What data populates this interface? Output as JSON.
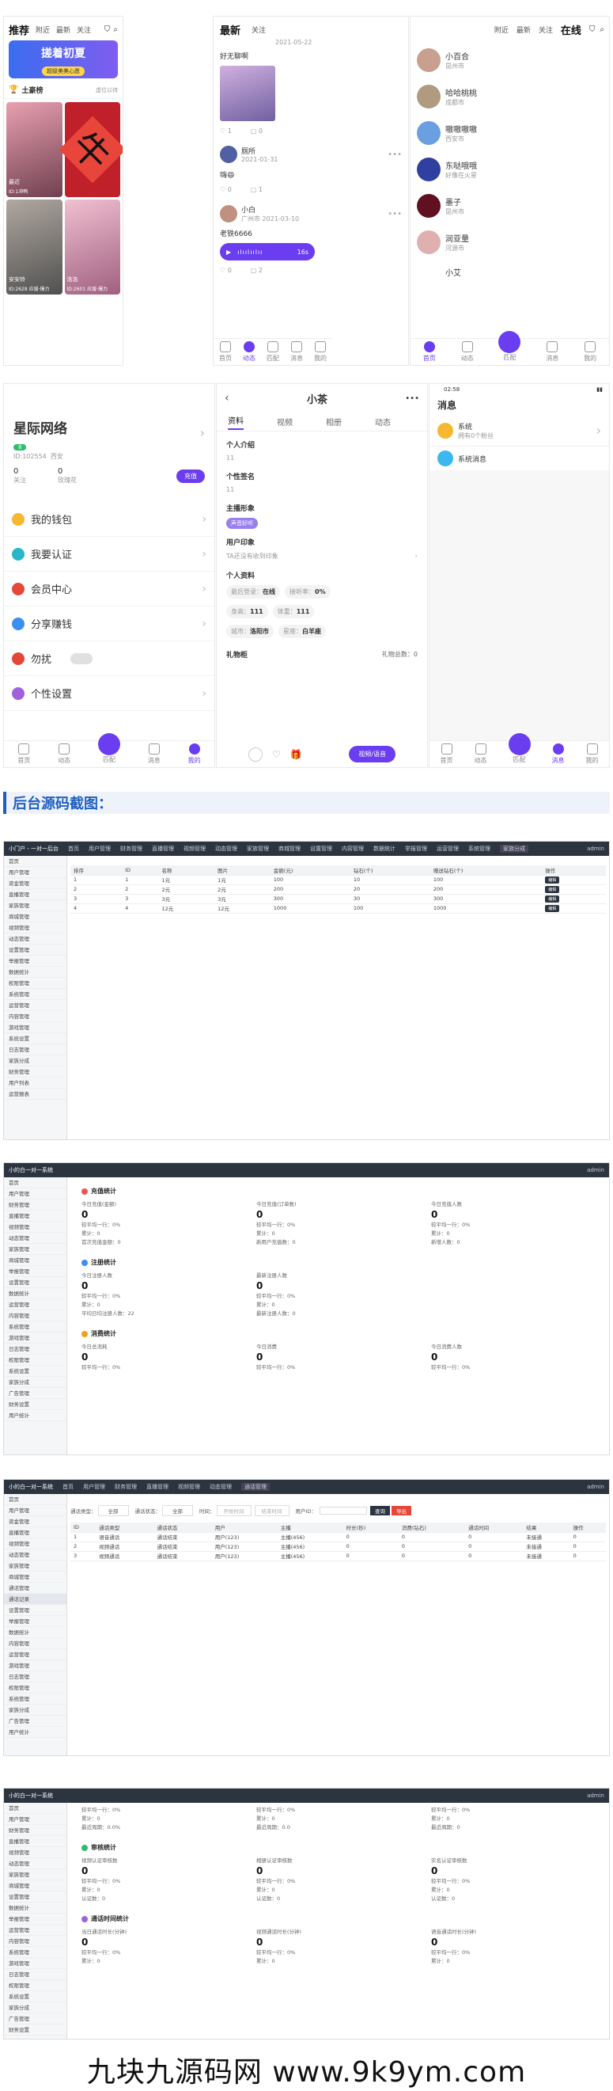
{
  "screen1": {
    "tabs": [
      "推荐",
      "附近",
      "最新",
      "关注"
    ],
    "banner_title": "搓着初夏",
    "banner_sub": "超级美美心愿",
    "rank_title": "土豪榜",
    "rank_more": "虚位以待",
    "card1_name": "安安铃",
    "card1_sub": "ID:2628 应援·爆力",
    "card2_name": "洛洛",
    "card2_sub": "ID:2601 应援·爆力",
    "card3_name": "最近",
    "card3_sub": "ID:1冲鸭",
    "fu_char": "牛"
  },
  "screen2": {
    "tabs": [
      "最新",
      "关注"
    ],
    "post1_text": "好无聊啊",
    "post1_date": "2021-05-22",
    "post2_name": "厕所",
    "post2_date": "2021-01-31",
    "post2_text": "嗨😄",
    "post3_name": "小白",
    "post3_loc": "广州市",
    "post3_date": "2021-03-10",
    "post3_text": "老铁6666",
    "voice_len": "16s",
    "likes": [
      "1",
      "0",
      "0",
      "1",
      "0",
      "2"
    ]
  },
  "screen3": {
    "tabs": [
      "附近",
      "最新",
      "关注",
      "在线"
    ],
    "users": [
      {
        "name": "小百合",
        "sub": "昆州市"
      },
      {
        "name": "哈哈桃桃",
        "sub": "成都市"
      },
      {
        "name": "嗷嗷嗷嗷",
        "sub": "西安市"
      },
      {
        "name": "东哒哦哦",
        "sub": "好像在火星"
      },
      {
        "name": "墨子",
        "sub": "昆州市"
      },
      {
        "name": "润亚量",
        "sub": "河源市"
      },
      {
        "name": "小艾",
        "sub": ""
      }
    ]
  },
  "tabbar_labels": [
    "首页",
    "动态",
    "匹配",
    "消息",
    "我的"
  ],
  "screen4": {
    "name": "星际网络",
    "badge": "8",
    "id": "ID:102554",
    "city": "西安",
    "follow_num": "0",
    "follow_label": "关注",
    "fans_num": "0",
    "fans_label": "玫瑰花",
    "recharge": "充值",
    "menu": [
      "我的钱包",
      "我要认证",
      "会员中心",
      "分享赚钱",
      "勿扰",
      "个性设置"
    ]
  },
  "screen5": {
    "title": "小茶",
    "tabs": [
      "资料",
      "视频",
      "相册",
      "动态"
    ],
    "intro_h": "个人介绍",
    "intro_v": "11",
    "sign_h": "个性签名",
    "sign_v": "11",
    "image_h": "主播形象",
    "image_tag": "声音好听",
    "impress_h": "用户印象",
    "impress_v": "TA还没有收到印象",
    "profile_h": "个人资料",
    "last_login": "最后登录：",
    "last_login_v": "在线",
    "rate": "接听率：",
    "rate_v": "0%",
    "height_l": "身高：",
    "height_v": "111",
    "weight_l": "体重：",
    "weight_v": "111",
    "city_l": "城市：",
    "city_v": "洛阳市",
    "sign2_l": "星座：",
    "sign2_v": "白羊座",
    "gift_h": "礼物柜",
    "gift_total": "礼物总数：0",
    "call_btn": "视频/语音"
  },
  "screen6": {
    "time": "02:58",
    "title": "消息",
    "items": [
      {
        "name": "系统",
        "sub": "拥有0个粉丝"
      },
      {
        "name": "系统消息",
        "sub": ""
      }
    ]
  },
  "section_title": "后台源码截图：",
  "admin1": {
    "brand": "小门户 - 一对一后台",
    "nav": [
      "首页",
      "用户管理",
      "财务管理",
      "直播管理",
      "视频管理",
      "动态管理",
      "家族管理",
      "商城管理",
      "设置管理",
      "内容管理",
      "数据统计",
      "举报管理",
      "运营管理",
      "系统管理",
      "家族分成"
    ],
    "user": "admin",
    "side": [
      "首页",
      "用户管理",
      "资金管理",
      "直播管理",
      "家族管理",
      "商城管理",
      "视频管理",
      "动态管理",
      "设置管理",
      "举报管理",
      "数据统计",
      "权限管理",
      "系统管理",
      "运营管理",
      "内容管理",
      "游戏管理",
      "系统设置",
      "日志管理",
      "家族分成",
      "财务管理",
      "用户列表",
      "运营报表"
    ],
    "head": [
      "排序",
      "ID",
      "名称",
      "图片",
      "金额(元)",
      "钻石(个)",
      "赠送钻石(个)",
      "操作"
    ],
    "rows": [
      [
        "1",
        "1",
        "1元",
        "1元",
        "100",
        "10",
        "100",
        "编辑"
      ],
      [
        "2",
        "2",
        "2元",
        "2元",
        "200",
        "20",
        "200",
        "编辑"
      ],
      [
        "3",
        "3",
        "3元",
        "3元",
        "300",
        "30",
        "300",
        "编辑"
      ],
      [
        "4",
        "4",
        "12元",
        "12元",
        "1000",
        "100",
        "1000",
        "编辑"
      ]
    ]
  },
  "admin2": {
    "brand": "小的白一对一系统",
    "user": "admin",
    "side": [
      "首页",
      "用户管理",
      "财务管理",
      "直播管理",
      "视频管理",
      "动态管理",
      "家族管理",
      "商城管理",
      "举报管理",
      "设置管理",
      "数据统计",
      "运营管理",
      "内容管理",
      "系统管理",
      "游戏管理",
      "日志管理",
      "权限管理",
      "系统设置",
      "家族分成",
      "广告管理",
      "财务设置",
      "用户统计"
    ],
    "sec1": "充值统计",
    "sec1_items": [
      [
        "今日充值(金额)",
        "0",
        "较平均一行：0%",
        "累计：0",
        "首次充值金额：0"
      ],
      [
        "今日充值(订单数)",
        "0",
        "较平均一行：0%",
        "累计：0",
        "新用户充值数：0"
      ],
      [
        "今日充值人数",
        "0",
        "较平均一行：0%",
        "累计：0",
        "新增人数：0"
      ]
    ],
    "sec2": "注册统计",
    "sec2_items": [
      [
        "今日注册人数",
        "0",
        "较平均一行：0%",
        "累计：0",
        "平均日均注册人数：22"
      ],
      [
        "最新注册人数",
        "0",
        "较平均一行：0%",
        "累计：0",
        "最新注册人数：0"
      ]
    ],
    "sec3": "消费统计",
    "sec3_items": [
      [
        "今日总消耗",
        "0",
        "较平均一行：0%"
      ],
      [
        "今日消费",
        "0",
        "较平均一行：0%"
      ],
      [
        "今日消费人数",
        "0",
        "较平均一行：0%"
      ]
    ]
  },
  "admin3": {
    "brand": "小的白一对一系统",
    "user": "admin",
    "nav": [
      "首页",
      "用户管理",
      "财务管理",
      "直播管理",
      "视频管理",
      "动态管理",
      "通话管理"
    ],
    "side": [
      "首页",
      "用户管理",
      "资金管理",
      "直播管理",
      "视频管理",
      "动态管理",
      "家族管理",
      "商城管理",
      "通话管理",
      "通话记录",
      "设置管理",
      "举报管理",
      "数据统计",
      "内容管理",
      "运营管理",
      "游戏管理",
      "日志管理",
      "权限管理",
      "系统管理",
      "家族分成",
      "广告管理",
      "用户统计"
    ],
    "filters": [
      "通话类型：",
      "全部",
      "通话状态：",
      "全部",
      "时间：",
      "开始时间",
      "结束时间",
      "用户ID：",
      "查询",
      "导出"
    ],
    "head": [
      "ID",
      "通话类型",
      "通话状态",
      "用户",
      "主播",
      "时长(秒)",
      "消费(钻石)",
      "通话时间",
      "结果",
      "操作"
    ],
    "rows": [
      [
        "1",
        "语音通话",
        "通话结束",
        "用户(123)",
        "主播(456)",
        "0",
        "0",
        "0",
        "未接通",
        "0"
      ],
      [
        "2",
        "视频通话",
        "通话结束",
        "用户(123)",
        "主播(456)",
        "0",
        "0",
        "0",
        "未接通",
        "0"
      ],
      [
        "3",
        "视频通话",
        "通话结束",
        "用户(123)",
        "主播(456)",
        "0",
        "0",
        "0",
        "未接通",
        "0"
      ]
    ]
  },
  "admin4": {
    "brand": "小的白一对一系统",
    "user": "admin",
    "side": [
      "首页",
      "用户管理",
      "财务管理",
      "直播管理",
      "视频管理",
      "动态管理",
      "家族管理",
      "商城管理",
      "设置管理",
      "数据统计",
      "举报管理",
      "运营管理",
      "内容管理",
      "系统管理",
      "游戏管理",
      "日志管理",
      "权限管理",
      "系统设置",
      "家族分成",
      "广告管理",
      "财务设置",
      "用户统计"
    ],
    "top_items": [
      [
        "较平均一行：0%",
        "累计：0",
        "最近周期：0.0%"
      ],
      [
        "较平均一行：0%",
        "累计：0",
        "最近周期：0.0"
      ],
      [
        "较平均一行：0%",
        "累计：0",
        "最近周期：0"
      ]
    ],
    "sec1": "审核统计",
    "sec1_items": [
      [
        "视频认证审核数",
        "0",
        "较平均一行：0%",
        "累计：0",
        "认证数：0"
      ],
      [
        "相册认证审核数",
        "0",
        "较平均一行：0%",
        "累计：0",
        "认证数：0"
      ],
      [
        "实名认证审核数",
        "0",
        "较平均一行：0%",
        "累计：0",
        "认证数：0"
      ]
    ],
    "sec2": "通话时间统计",
    "sec2_items": [
      [
        "当日通话时长(分钟)",
        "0",
        "较平均一行：0%",
        "累计：0"
      ],
      [
        "视频通话时长(分钟)",
        "0",
        "较平均一行：0%",
        "累计：0"
      ],
      [
        "语音通话时长(分钟)",
        "0",
        "较平均一行：0%",
        "累计：0"
      ]
    ]
  },
  "watermark": "九块九源码网 www.9k9ym.com"
}
